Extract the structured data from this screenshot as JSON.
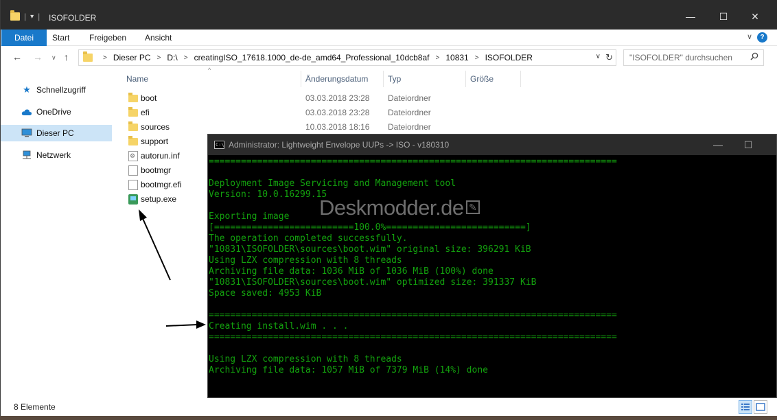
{
  "window": {
    "title": "ISOFOLDER",
    "minimize": "—",
    "maximize": "☐",
    "close": "✕"
  },
  "ribbon": {
    "tabs": [
      "Datei",
      "Start",
      "Freigeben",
      "Ansicht"
    ],
    "active_tab": "Datei",
    "expand": "∨",
    "help": "?"
  },
  "nav": {
    "back": "←",
    "forward": "→",
    "recent": "∨",
    "up": "↑"
  },
  "address": {
    "crumbs": [
      "Dieser PC",
      "D:\\",
      "creatingISO_17618.1000_de-de_amd64_Professional_10dcb8af",
      "10831",
      "ISOFOLDER"
    ],
    "separator": ">",
    "dropdown": "∨",
    "refresh": "↻"
  },
  "search": {
    "placeholder": "\"ISOFOLDER\" durchsuchen",
    "icon": "search-icon"
  },
  "navpane": {
    "items": [
      {
        "label": "Schnellzugriff",
        "icon": "star-icon",
        "color": "#1979ca"
      },
      {
        "label": "OneDrive",
        "icon": "cloud-icon",
        "color": "#1979ca"
      },
      {
        "label": "Dieser PC",
        "icon": "computer-icon",
        "color": "#1979ca",
        "selected": true
      },
      {
        "label": "Netzwerk",
        "icon": "network-icon",
        "color": "#1979ca"
      }
    ]
  },
  "columns": [
    "Name",
    "Änderungsdatum",
    "Typ",
    "Größe"
  ],
  "sort_indicator": "^",
  "files": [
    {
      "name": "boot",
      "date": "03.03.2018 23:28",
      "type": "Dateiordner",
      "icon": "folder-icon"
    },
    {
      "name": "efi",
      "date": "03.03.2018 23:28",
      "type": "Dateiordner",
      "icon": "folder-icon"
    },
    {
      "name": "sources",
      "date": "10.03.2018 18:16",
      "type": "Dateiordner",
      "icon": "folder-icon"
    },
    {
      "name": "support",
      "date": "",
      "type": "",
      "icon": "folder-icon"
    },
    {
      "name": "autorun.inf",
      "date": "",
      "type": "",
      "icon": "settings-file-icon"
    },
    {
      "name": "bootmgr",
      "date": "",
      "type": "",
      "icon": "file-icon"
    },
    {
      "name": "bootmgr.efi",
      "date": "",
      "type": "",
      "icon": "file-icon"
    },
    {
      "name": "setup.exe",
      "date": "",
      "type": "",
      "icon": "setup-exe-icon"
    }
  ],
  "status": {
    "count": "8 Elemente"
  },
  "console": {
    "title": "Administrator:  Lightweight Envelope UUPs -> ISO - v180310",
    "minimize": "—",
    "maximize": "☐",
    "lines": [
      "============================================================================",
      "",
      "Deployment Image Servicing and Management tool",
      "Version: 10.0.16299.15",
      "",
      "Exporting image",
      "[==========================100.0%==========================]",
      "The operation completed successfully.",
      "\"10831\\ISOFOLDER\\sources\\boot.wim\" original size: 396291 KiB",
      "Using LZX compression with 8 threads",
      "Archiving file data: 1036 MiB of 1036 MiB (100%) done",
      "\"10831\\ISOFOLDER\\sources\\boot.wim\" optimized size: 391337 KiB",
      "Space saved: 4953 KiB",
      "",
      "============================================================================",
      "Creating install.wim . . .",
      "============================================================================",
      "",
      "Using LZX compression with 8 threads",
      "Archiving file data: 1057 MiB of 7379 MiB (14%) done"
    ]
  },
  "watermark": {
    "text": "Deskmodder.de",
    "pen": "✎"
  },
  "colors": {
    "accent": "#1979ca",
    "console_text": "#13a10e",
    "titlebar": "#2b2b2b"
  }
}
